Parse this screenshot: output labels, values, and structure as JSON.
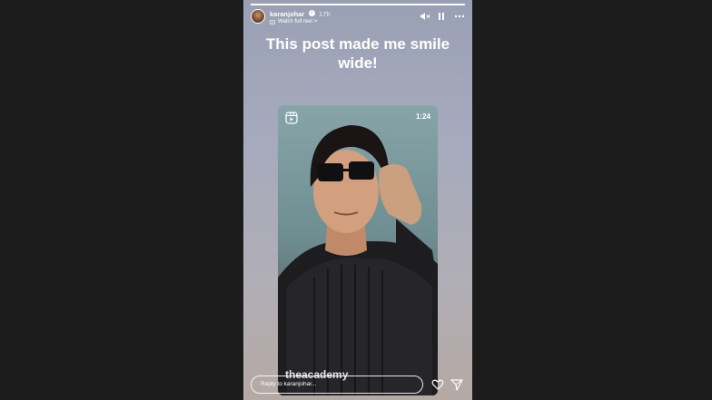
{
  "story": {
    "username": "karanjohar",
    "timestamp": "17h",
    "watch_label": "Watch full reel >",
    "caption": "This post made me smile wide!",
    "progress": 1.0
  },
  "reel": {
    "duration": "1:24",
    "watermark": "theacademy"
  },
  "footer": {
    "reply_placeholder": "Reply to karanjohar..."
  },
  "icons": {
    "mute": "speaker-muted-icon",
    "pause": "pause-icon",
    "more": "more-icon",
    "reel": "reels-icon",
    "like": "heart-icon",
    "share": "send-icon",
    "verified": "verified-badge-icon",
    "watch": "reel-small-icon"
  },
  "colors": {
    "background": "#1c1c1c",
    "accent_verified": "#3897f0"
  }
}
